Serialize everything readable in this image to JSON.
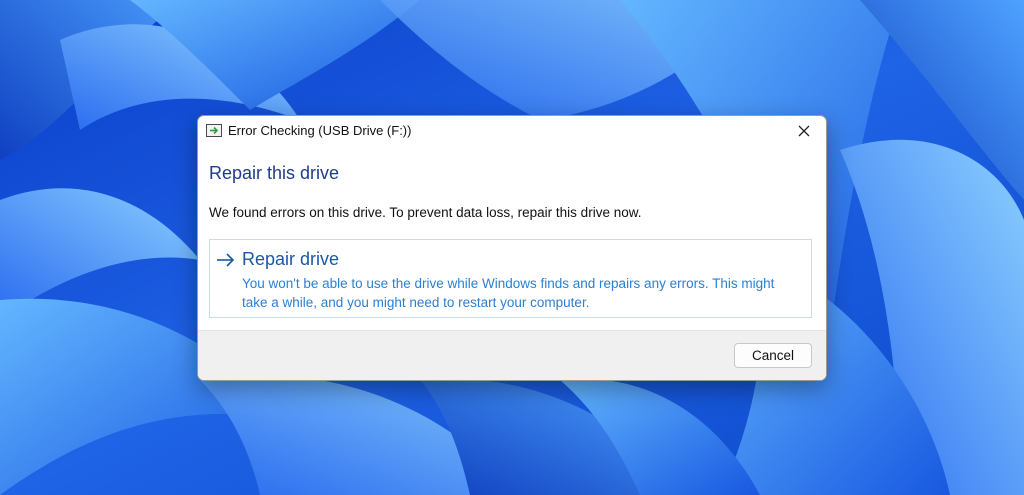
{
  "dialog": {
    "title": "Error Checking (USB Drive (F:))",
    "heading": "Repair this drive",
    "message": "We found errors on this drive. To prevent data loss, repair this drive now.",
    "command_link": {
      "title": "Repair drive",
      "description": "You won't be able to use the drive while Windows finds and repairs any errors. This might take a while, and you might need to restart your computer."
    },
    "cancel_label": "Cancel"
  },
  "icons": {
    "title": "drive-check-icon",
    "close": "close-icon",
    "command_arrow": "arrow-right-icon"
  },
  "colors": {
    "heading": "#1f3b8f",
    "link_title": "#1a58a6",
    "link_text": "#2c7fd2",
    "wallpaper_blue": "#1f63e6"
  }
}
